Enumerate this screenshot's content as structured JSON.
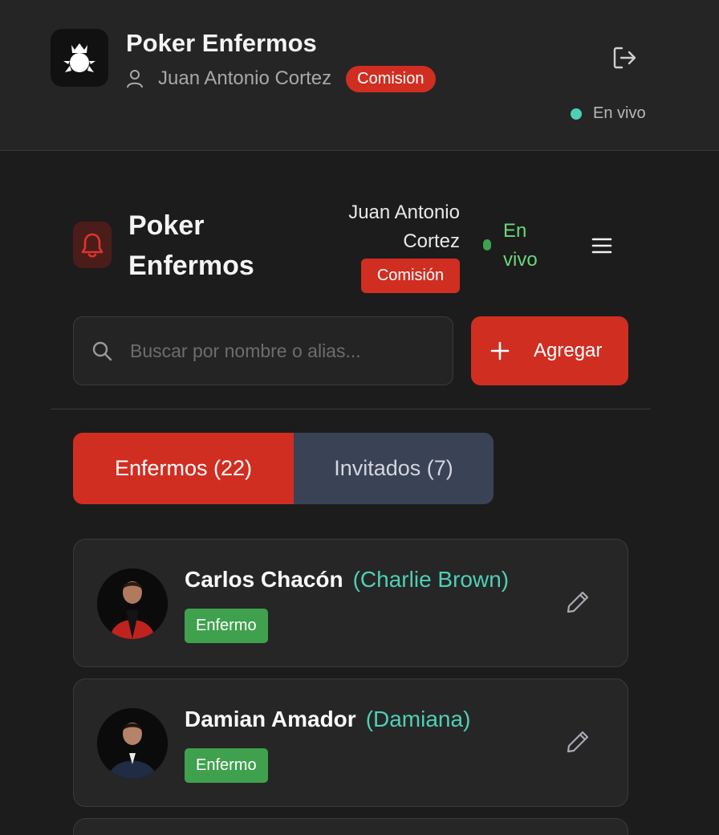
{
  "app": {
    "title": "Poker Enfermos",
    "user_name": "Juan Antonio Cortez",
    "role_badge": "Comision",
    "live_status": "En vivo",
    "logo_icon": "crown-club-logo",
    "user_icon": "person-icon",
    "logout_icon": "logout-icon"
  },
  "inner_header": {
    "title": "Poker Enfermos",
    "user_name": "Juan Antonio Cortez",
    "role_badge": "Comisión",
    "live_status": "En vivo",
    "bell_icon": "bell-icon",
    "menu_icon": "hamburger-menu-icon"
  },
  "search": {
    "placeholder": "Buscar por nombre o alias..."
  },
  "add_button": {
    "label": "Agregar"
  },
  "tabs": [
    {
      "label": "Enfermos (22)",
      "active": true
    },
    {
      "label": "Invitados (7)",
      "active": false
    }
  ],
  "players": [
    {
      "name": "Carlos Chacón",
      "alias": "(Charlie Brown)",
      "status": "Enfermo"
    },
    {
      "name": "Damian Amador",
      "alias": "(Damiana)",
      "status": "Enfermo"
    }
  ],
  "colors": {
    "accent_red": "#d12e22",
    "teal": "#4fcfb6",
    "green": "#3fa14d",
    "tab_inactive": "#3a4356"
  }
}
